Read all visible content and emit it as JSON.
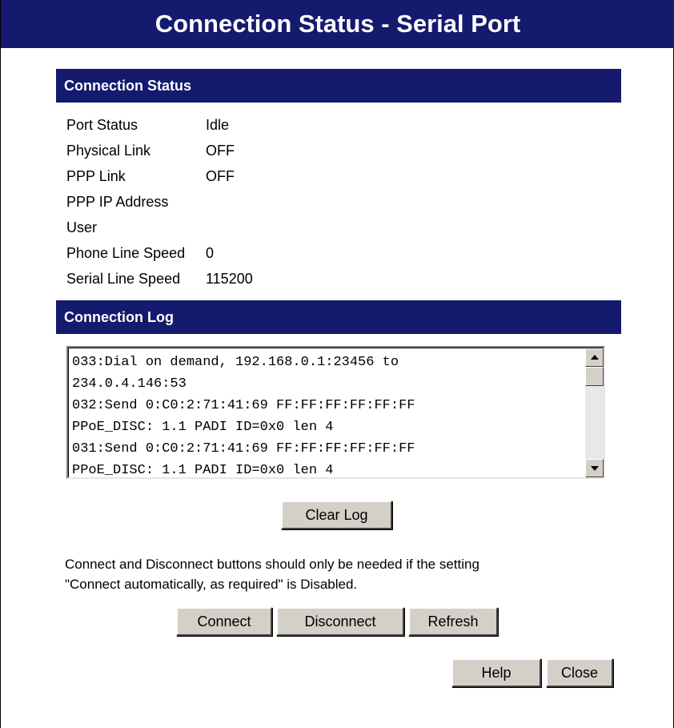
{
  "page": {
    "title": "Connection Status - Serial Port"
  },
  "connection_status": {
    "heading": "Connection Status",
    "rows": [
      {
        "label": "Port Status",
        "value": "Idle"
      },
      {
        "label": "Physical Link",
        "value": "OFF"
      },
      {
        "label": "PPP Link",
        "value": "OFF"
      },
      {
        "label": "PPP IP Address",
        "value": ""
      },
      {
        "label": "User",
        "value": ""
      },
      {
        "label": "Phone Line Speed",
        "value": "0"
      },
      {
        "label": "Serial Line Speed",
        "value": "115200"
      }
    ]
  },
  "connection_log": {
    "heading": "Connection Log",
    "lines": [
      "033:Dial on demand, 192.168.0.1:23456 to",
      "234.0.4.146:53",
      "032:Send 0:C0:2:71:41:69 FF:FF:FF:FF:FF:FF",
      "PPoE_DISC: 1.1 PADI ID=0x0 len 4",
      "031:Send 0:C0:2:71:41:69 FF:FF:FF:FF:FF:FF",
      "PPoE_DISC: 1.1 PADI ID=0x0 len 4"
    ],
    "clear_label": "Clear Log"
  },
  "note": {
    "line1": "Connect and Disconnect buttons should only be needed if the setting",
    "line2": "\"Connect automatically, as required\" is Disabled."
  },
  "actions": {
    "connect_label": "Connect",
    "disconnect_label": "Disconnect",
    "refresh_label": "Refresh",
    "help_label": "Help",
    "close_label": "Close"
  },
  "colors": {
    "header_background": "#141a6e",
    "button_face": "#d4d0c8"
  }
}
